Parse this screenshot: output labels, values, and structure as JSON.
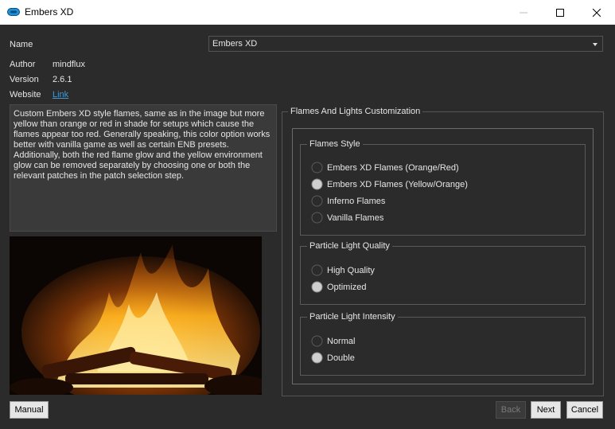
{
  "window": {
    "title": "Embers XD"
  },
  "info": {
    "name_label": "Name",
    "name_value": "Embers XD",
    "author_label": "Author",
    "author_value": "mindflux",
    "version_label": "Version",
    "version_value": "2.6.1",
    "website_label": "Website",
    "website_link": "Link"
  },
  "description": "Custom Embers XD style flames, same as in the image but more yellow than orange or red in shade for setups which cause the flames appear too red. Generally speaking, this color option works better with vanilla game as well as certain ENB presets. Additionally, both the red flame glow and the yellow environment glow can be removed separately by choosing one or both the relevant patches in the patch selection step.",
  "customization": {
    "title": "Flames And Lights Customization",
    "groups": [
      {
        "title": "Flames Style",
        "options": [
          {
            "label": "Embers XD Flames (Orange/Red)",
            "selected": false
          },
          {
            "label": "Embers XD Flames (Yellow/Orange)",
            "selected": true
          },
          {
            "label": "Inferno Flames",
            "selected": false
          },
          {
            "label": "Vanilla Flames",
            "selected": false
          }
        ]
      },
      {
        "title": "Particle Light Quality",
        "options": [
          {
            "label": "High Quality",
            "selected": false
          },
          {
            "label": "Optimized",
            "selected": true
          }
        ]
      },
      {
        "title": "Particle Light Intensity",
        "options": [
          {
            "label": "Normal",
            "selected": false
          },
          {
            "label": "Double",
            "selected": true
          }
        ]
      }
    ]
  },
  "buttons": {
    "manual": "Manual",
    "back": "Back",
    "next": "Next",
    "cancel": "Cancel"
  },
  "colors": {
    "background": "#2b2b2b",
    "link": "#3a9bdc",
    "accent_icon": "#1e90d6"
  }
}
